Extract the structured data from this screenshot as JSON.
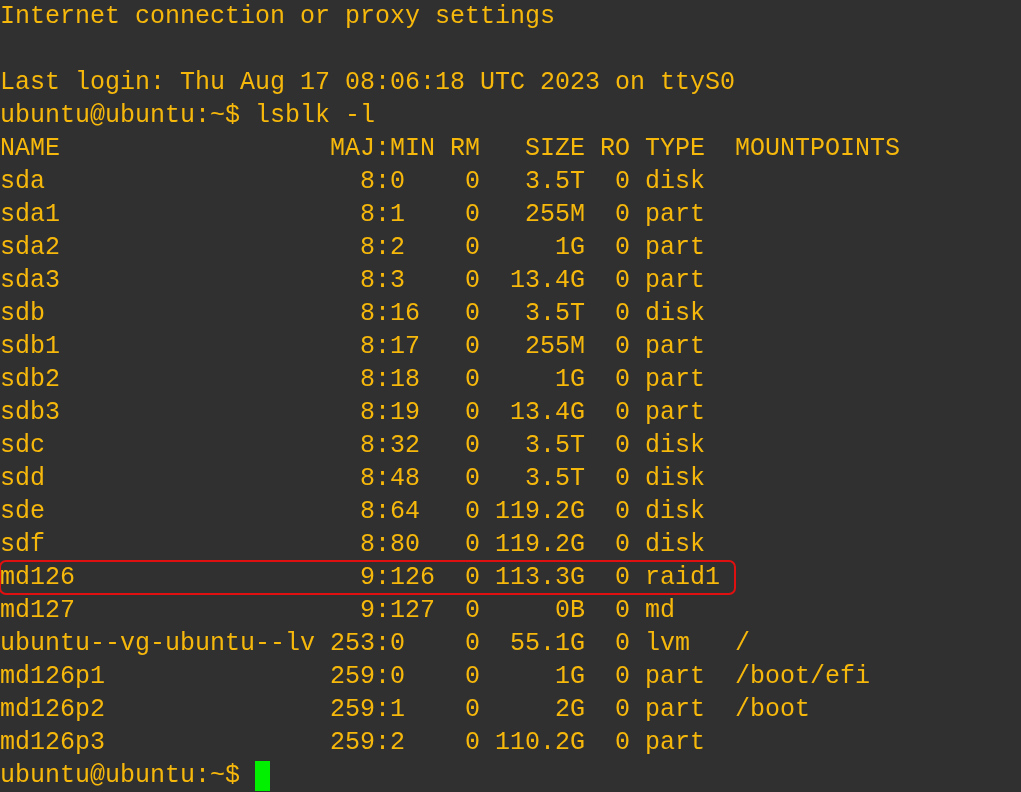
{
  "terminal": {
    "motd": "Internet connection or proxy settings",
    "last_login": "Last login: Thu Aug 17 08:06:18 UTC 2023 on ttyS0",
    "prompt": "ubuntu@ubuntu:~$",
    "command": "lsblk -l",
    "table": {
      "columns": {
        "name": "NAME",
        "maj_min": "MAJ:MIN",
        "rm": "RM",
        "size": "SIZE",
        "ro": "RO",
        "type": "TYPE",
        "mountpoints": "MOUNTPOINTS"
      },
      "rows": [
        {
          "name": "sda",
          "maj_min": "8:0",
          "rm": "0",
          "size": "3.5T",
          "ro": "0",
          "type": "disk",
          "highlighted": false
        },
        {
          "name": "sda1",
          "maj_min": "8:1",
          "rm": "0",
          "size": "255M",
          "ro": "0",
          "type": "part",
          "highlighted": false
        },
        {
          "name": "sda2",
          "maj_min": "8:2",
          "rm": "0",
          "size": "1G",
          "ro": "0",
          "type": "part",
          "highlighted": false
        },
        {
          "name": "sda3",
          "maj_min": "8:3",
          "rm": "0",
          "size": "13.4G",
          "ro": "0",
          "type": "part",
          "highlighted": false
        },
        {
          "name": "sdb",
          "maj_min": "8:16",
          "rm": "0",
          "size": "3.5T",
          "ro": "0",
          "type": "disk",
          "highlighted": false
        },
        {
          "name": "sdb1",
          "maj_min": "8:17",
          "rm": "0",
          "size": "255M",
          "ro": "0",
          "type": "part",
          "highlighted": false
        },
        {
          "name": "sdb2",
          "maj_min": "8:18",
          "rm": "0",
          "size": "1G",
          "ro": "0",
          "type": "part",
          "highlighted": false
        },
        {
          "name": "sdb3",
          "maj_min": "8:19",
          "rm": "0",
          "size": "13.4G",
          "ro": "0",
          "type": "part",
          "highlighted": false
        },
        {
          "name": "sdc",
          "maj_min": "8:32",
          "rm": "0",
          "size": "3.5T",
          "ro": "0",
          "type": "disk",
          "highlighted": false
        },
        {
          "name": "sdd",
          "maj_min": "8:48",
          "rm": "0",
          "size": "3.5T",
          "ro": "0",
          "type": "disk",
          "highlighted": false
        },
        {
          "name": "sde",
          "maj_min": "8:64",
          "rm": "0",
          "size": "119.2G",
          "ro": "0",
          "type": "disk",
          "highlighted": false
        },
        {
          "name": "sdf",
          "maj_min": "8:80",
          "rm": "0",
          "size": "119.2G",
          "ro": "0",
          "type": "disk",
          "highlighted": false
        },
        {
          "name": "md126",
          "maj_min": "9:126",
          "rm": "0",
          "size": "113.3G",
          "ro": "0",
          "type": "raid1",
          "highlighted": true
        },
        {
          "name": "md127",
          "maj_min": "9:127",
          "rm": "0",
          "size": "0B",
          "ro": "0",
          "type": "md",
          "highlighted": false
        },
        {
          "name": "ubuntu--vg-ubuntu--lv",
          "maj_min": "253:0",
          "rm": "0",
          "size": "55.1G",
          "ro": "0",
          "type": "lvm",
          "mountpoints": "/",
          "highlighted": false
        },
        {
          "name": "md126p1",
          "maj_min": "259:0",
          "rm": "0",
          "size": "1G",
          "ro": "0",
          "type": "part",
          "mountpoints": "/boot/efi",
          "highlighted": false
        },
        {
          "name": "md126p2",
          "maj_min": "259:1",
          "rm": "0",
          "size": "2G",
          "ro": "0",
          "type": "part",
          "mountpoints": "/boot",
          "highlighted": false
        },
        {
          "name": "md126p3",
          "maj_min": "259:2",
          "rm": "0",
          "size": "110.2G",
          "ro": "0",
          "type": "part",
          "highlighted": false
        }
      ]
    },
    "final_prompt": "ubuntu@ubuntu:~$"
  }
}
